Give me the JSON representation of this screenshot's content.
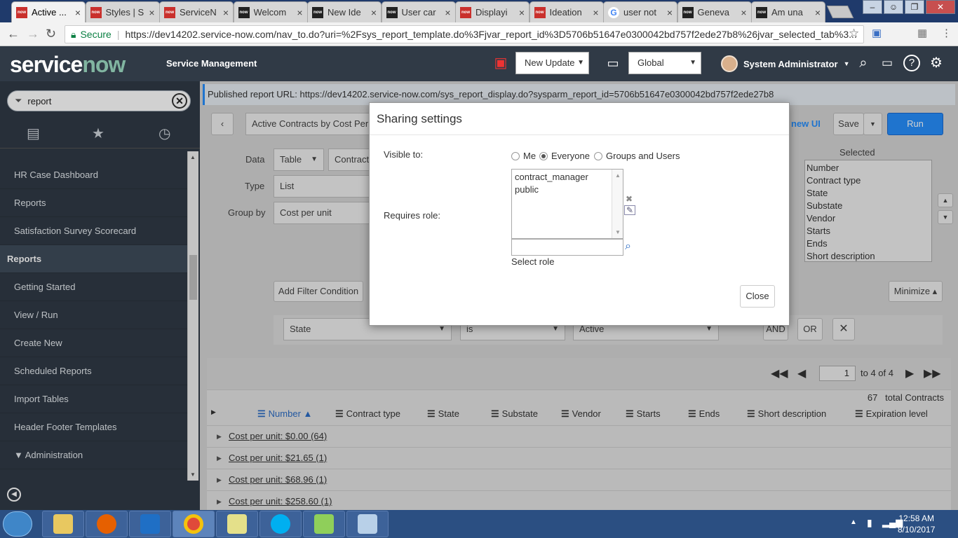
{
  "browser": {
    "tabs": [
      {
        "title": "Active ...",
        "icon": "now-red",
        "active": true
      },
      {
        "title": "Styles | S",
        "icon": "now-red"
      },
      {
        "title": "ServiceN",
        "icon": "now-red"
      },
      {
        "title": "Welcom",
        "icon": "now-black"
      },
      {
        "title": "New Ide",
        "icon": "now-black"
      },
      {
        "title": "User car",
        "icon": "now-black"
      },
      {
        "title": "Displayi",
        "icon": "now-red"
      },
      {
        "title": "Ideation",
        "icon": "now-red"
      },
      {
        "title": "user not",
        "icon": "google"
      },
      {
        "title": "Geneva",
        "icon": "now-black"
      },
      {
        "title": "Am una",
        "icon": "now-black"
      }
    ],
    "secure_label": "Secure",
    "url": "https://dev14202.service-now.com/nav_to.do?uri=%2Fsys_report_template.do%3Fjvar_report_id%3D5706b51647e0300042bd757f2ede27b8%26jvar_selected_tab%3..."
  },
  "header": {
    "logo_service": "service",
    "logo_now": "now",
    "product": "Service Management",
    "update_set": "New Update",
    "scope": "Global",
    "user": "System Administrator"
  },
  "sidebar": {
    "filter_value": "report",
    "items": [
      {
        "label": "HR Case Dashboard"
      },
      {
        "label": "Reports"
      },
      {
        "label": "Satisfaction Survey Scorecard"
      },
      {
        "label": "Reports",
        "group": true
      },
      {
        "label": "Getting Started"
      },
      {
        "label": "View / Run"
      },
      {
        "label": "Create New"
      },
      {
        "label": "Scheduled Reports"
      },
      {
        "label": "Import Tables"
      },
      {
        "label": "Header Footer Templates"
      },
      {
        "label": "▼ Administration"
      }
    ]
  },
  "report": {
    "published_url": "Published report URL: https://dev14202.service-now.com/sys_report_display.do?sysparm_report_id=5706b51647e0300042bd757f2ede27b8",
    "title": "Active Contracts by Cost Per Ur",
    "new_ui_link": "new UI",
    "save_label": "Save",
    "run_label": "Run",
    "data_label": "Data",
    "data_source": "Table",
    "data_table": "Contract",
    "type_label": "Type",
    "type_value": "List",
    "groupby_label": "Group by",
    "groupby_value": "Cost per unit",
    "selected_label": "Selected",
    "selected_columns": [
      "Number",
      "Contract type",
      "State",
      "Substate",
      "Vendor",
      "Starts",
      "Ends",
      "Short description"
    ],
    "add_filter": "Add Filter Condition",
    "minimize": "Minimize ▴",
    "filter_field": "State",
    "filter_op": "is",
    "filter_value": "Active",
    "and_label": "AND",
    "or_label": "OR"
  },
  "results": {
    "page": "1",
    "page_of": "to 4 of 4",
    "total_count": "67",
    "total_label": "total Contracts",
    "columns": [
      "Number ▲",
      "Contract type",
      "State",
      "Substate",
      "Vendor",
      "Starts",
      "Ends",
      "Short description",
      "Expiration level"
    ],
    "groups": [
      "Cost per unit: $0.00 (64)",
      "Cost per unit: $21.65 (1)",
      "Cost per unit: $68.96 (1)",
      "Cost per unit: $258.60 (1)"
    ]
  },
  "modal": {
    "title": "Sharing settings",
    "visible_to_label": "Visible to:",
    "options": [
      "Me",
      "Everyone",
      "Groups and Users"
    ],
    "selected_option": "Everyone",
    "requires_role_label": "Requires role:",
    "roles": [
      "contract_manager",
      "public"
    ],
    "select_role_label": "Select role",
    "close_label": "Close"
  },
  "taskbar": {
    "time": "12:58 AM",
    "date": "8/10/2017"
  },
  "colors": {
    "header_bg": "#303a46",
    "accent": "#278efc",
    "logo_now": "#81b5a1"
  }
}
